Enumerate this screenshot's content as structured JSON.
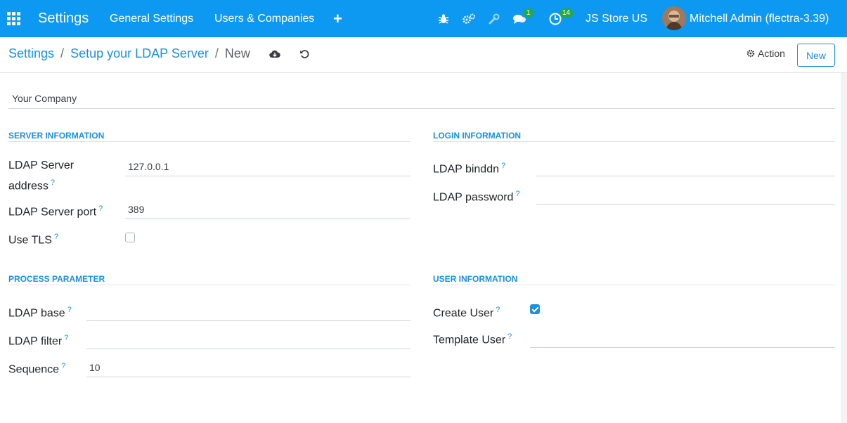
{
  "navbar": {
    "app_title": "Settings",
    "menu": [
      "General Settings",
      "Users & Companies"
    ],
    "add_label": "+",
    "messages_count": "1",
    "activities_count": "14",
    "company": "JS Store US",
    "user": "Mitchell Admin (flectra-3.39)"
  },
  "breadcrumb": {
    "root": "Settings",
    "parent": "Setup your LDAP Server",
    "current": "New",
    "sep": "/"
  },
  "control": {
    "action_label": "Action",
    "new_label": "New"
  },
  "form": {
    "company": "Your Company",
    "server_section": "SERVER INFORMATION",
    "login_section": "LOGIN INFORMATION",
    "process_section": "PROCESS PARAMETER",
    "user_section": "USER INFORMATION",
    "server_address_label_1": "LDAP Server",
    "server_address_label_2": "address",
    "server_address": "127.0.0.1",
    "server_port_label": "LDAP Server port",
    "server_port": "389",
    "tls_label": "Use TLS",
    "binddn_label": "LDAP binddn",
    "binddn": "",
    "password_label": "LDAP password",
    "password": "",
    "base_label": "LDAP base",
    "base": "",
    "filter_label": "LDAP filter",
    "filter": "",
    "sequence_label": "Sequence",
    "sequence": "10",
    "create_user_label": "Create User",
    "template_user_label": "Template User",
    "template_user": "",
    "help_mark": "?"
  }
}
